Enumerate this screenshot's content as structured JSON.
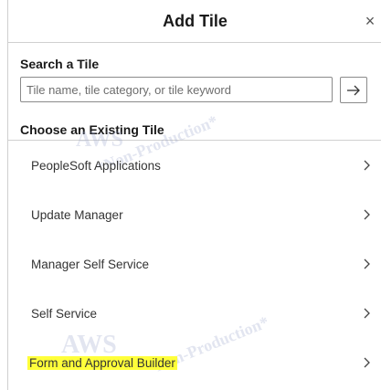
{
  "dialog": {
    "title": "Add Tile",
    "close_symbol": "×"
  },
  "search": {
    "label": "Search a Tile",
    "placeholder": "Tile name, tile category, or tile keyword"
  },
  "choose": {
    "label": "Choose an Existing Tile",
    "items": [
      {
        "label": "PeopleSoft Applications",
        "highlighted": false
      },
      {
        "label": "Update Manager",
        "highlighted": false
      },
      {
        "label": "Manager Self Service",
        "highlighted": false
      },
      {
        "label": "Self Service",
        "highlighted": false
      },
      {
        "label": "Form and Approval Builder",
        "highlighted": true
      }
    ]
  },
  "watermark": {
    "line1": "AWS",
    "line2": "*Non-Production*"
  },
  "colors": {
    "highlight": "#ffff3a",
    "divider": "#d0d0d0",
    "text": "#333333"
  },
  "icons": {
    "go": "arrow-right-icon",
    "item": "chevron-right-icon",
    "close": "close-icon"
  }
}
